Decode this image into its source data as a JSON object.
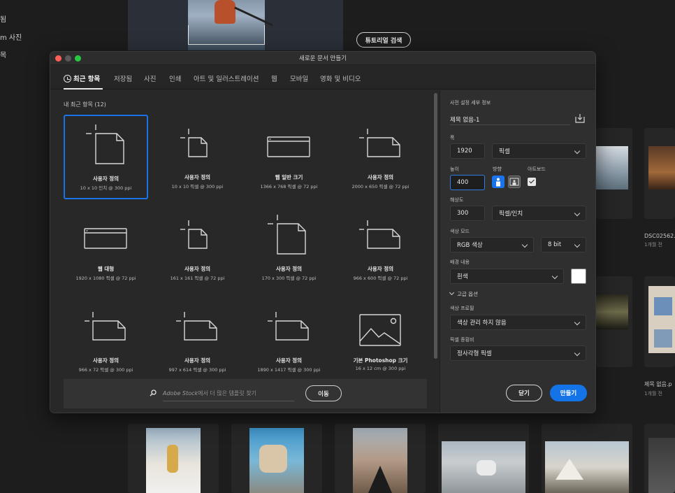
{
  "background": {
    "sidebar_items": [
      "됨",
      "m 사진",
      "목"
    ],
    "tutorial_button": "튜토리얼 검색",
    "recent_files": [
      {
        "name": "DSC02562.",
        "time": "1개월 전"
      },
      {
        "name": "제목 없음.p",
        "time": "1개월 전"
      }
    ]
  },
  "dialog": {
    "title": "새로운 문서 만들기",
    "tabs": [
      "최근 항목",
      "저장됨",
      "사진",
      "인쇄",
      "아트 및 일러스트레이션",
      "웹",
      "모바일",
      "영화 및 비디오"
    ],
    "active_tab": "최근 항목",
    "section_title": "내 최근 항목  (12)",
    "presets": [
      {
        "name": "사용자 정의",
        "dims": "10 x 10 인치 @ 300 ppi",
        "icon": "custom-portrait"
      },
      {
        "name": "사용자 정의",
        "dims": "10 x 10 픽셀 @ 300 ppi",
        "icon": "custom-small"
      },
      {
        "name": "웹 일반 크기",
        "dims": "1366 x 768 픽셀 @ 72 ppi",
        "icon": "web-window"
      },
      {
        "name": "사용자 정의",
        "dims": "2000 x 650 픽셀 @ 72 ppi",
        "icon": "custom-landscape"
      },
      {
        "name": "웹 대형",
        "dims": "1920 x 1080 픽셀 @ 72 ppi",
        "icon": "web-window"
      },
      {
        "name": "사용자 정의",
        "dims": "161 x 161 픽셀 @ 72 ppi",
        "icon": "custom-small"
      },
      {
        "name": "사용자 정의",
        "dims": "170 x 300 픽셀 @ 72 ppi",
        "icon": "custom-portrait"
      },
      {
        "name": "사용자 정의",
        "dims": "966 x 600 픽셀 @ 72 ppi",
        "icon": "custom-landscape"
      },
      {
        "name": "사용자 정의",
        "dims": "966 x 72 픽셀 @ 300 ppi",
        "icon": "custom-landscape"
      },
      {
        "name": "사용자 정의",
        "dims": "997 x 614 픽셀 @ 300 ppi",
        "icon": "custom-landscape"
      },
      {
        "name": "사용자 정의",
        "dims": "1890 x 1417 픽셀 @ 300 ppi",
        "icon": "custom-landscape"
      },
      {
        "name": "기본 Photoshop 크기",
        "dims": "16 x 12 cm @ 300 ppi",
        "icon": "photo"
      }
    ],
    "search": {
      "brand": "Adobe Stock",
      "text": "에서 더 많은 템플릿 찾기",
      "go_label": "이동"
    },
    "details": {
      "header": "사전 설정 세부 정보",
      "doc_name": "제목 없음-1",
      "width_label": "폭",
      "width_value": "1920",
      "unit": "픽셀",
      "height_label": "높이",
      "height_value": "400",
      "orientation_label": "방향",
      "artboard_label": "아트보드",
      "artboard_checked": true,
      "resolution_label": "해상도",
      "resolution_value": "300",
      "resolution_unit": "픽셀/인치",
      "color_mode_label": "색상 모드",
      "color_mode": "RGB 색상",
      "bit_depth": "8 bit",
      "bg_label": "배경 내용",
      "bg_value": "흰색",
      "bg_color": "#ffffff",
      "advanced_label": "고급 옵션",
      "profile_label": "색상 프로필",
      "profile_value": "색상 관리 하지 않음",
      "ratio_label": "픽셀 종횡비",
      "ratio_value": "정사각형 픽셀",
      "close_label": "닫기",
      "create_label": "만들기"
    },
    "accent_color": "#1473e6"
  }
}
